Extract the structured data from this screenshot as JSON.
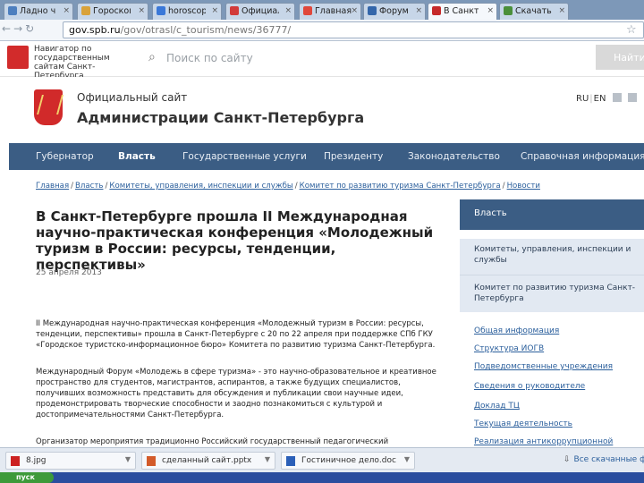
{
  "browser": {
    "tabs": [
      {
        "label": "Ладно ч",
        "active": false
      },
      {
        "label": "Гороскоп",
        "active": false
      },
      {
        "label": "horoscop",
        "active": false
      },
      {
        "label": "Официаль",
        "active": false
      },
      {
        "label": "Главная",
        "active": false
      },
      {
        "label": "Форум",
        "active": false
      },
      {
        "label": "В Санкт",
        "active": true
      },
      {
        "label": "Скачать",
        "active": false
      }
    ],
    "url_host": "gov.spb.ru",
    "url_path": "/gov/otrasl/c_tourism/news/36777/"
  },
  "site_top": {
    "nav_lines": [
      "Навигатор по",
      "государственным",
      "сайтам Санкт-Петербурга"
    ],
    "search_placeholder": "Поиск по сайту",
    "search_button": "Найти"
  },
  "header": {
    "official_label": "Официальный сайт",
    "admin_title": "Администрации Санкт-Петербурга",
    "lang_ru": "RU",
    "lang_en": "EN"
  },
  "main_nav": [
    {
      "label": "Губернатор",
      "active": false
    },
    {
      "label": "Власть",
      "active": true
    },
    {
      "label": "Государственные услуги",
      "active": false
    },
    {
      "label": "Президенту",
      "active": false
    },
    {
      "label": "Законодательство",
      "active": false
    },
    {
      "label": "Справочная информация",
      "active": false
    }
  ],
  "breadcrumb": [
    "Главная",
    "Власть",
    "Комитеты, управления, инспекции и службы",
    "Комитет по развитию туризма Санкт-Петербурга",
    "Новости"
  ],
  "article": {
    "title": "В Санкт-Петербурге прошла II Международная научно-практическая конференция «Молодежный туризм в России: ресурсы, тенденции, перспективы»",
    "date": "25 апреля 2013",
    "para1": "II Международная научно-практическая конференция «Молодежный туризм в России: ресурсы, тенденции, перспективы» прошла в Санкт-Петербурге с 20 по 22 апреля при поддержке СПб ГКУ «Городское туристско-информационное бюро» Комитета по развитию туризма Санкт-Петербурга.",
    "para2": "Международный Форум «Молодежь в сфере туризма» - это научно-образовательное и креативное пространство для студентов, магистрантов, аспирантов, а также будущих специалистов, получивших возможность представить для обсуждения и публикации свои научные идеи, продемонстрировать творческие способности и заодно познакомиться с культурой и достопримечательностями Санкт-Петербурга.",
    "para3": "Организатор мероприятия традиционно Российский государственный педагогический университет имени"
  },
  "sidebar": {
    "head": "Власть",
    "block1": "Комитеты, управления, инспекции и службы",
    "block2": "Комитет по развитию туризма Санкт-Петербурга",
    "links": [
      "Общая информация",
      "Структура ИОГВ",
      "Подведомственные учреждения",
      "Сведения о руководителе",
      "Доклад ТЦ",
      "Текущая деятельность",
      "Реализация антикоррупционной"
    ]
  },
  "downloads": {
    "items": [
      "8.jpg",
      "сделанный сайт.pptx",
      "Гостиничное дело.doc"
    ],
    "show_all": "Все скачанные файлы..."
  },
  "taskbar": {
    "start_label": "пуск"
  }
}
